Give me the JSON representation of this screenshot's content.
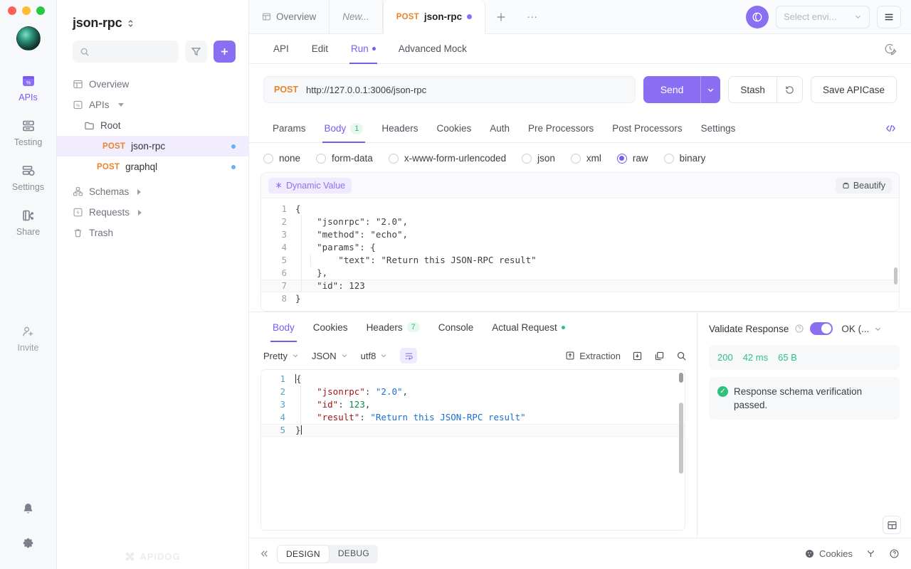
{
  "rail": {
    "items": [
      {
        "label": "APIs",
        "icon": "apis-icon",
        "active": true
      },
      {
        "label": "Testing",
        "icon": "testing-icon",
        "active": false
      },
      {
        "label": "Settings",
        "icon": "settings-icon",
        "active": false
      },
      {
        "label": "Share",
        "icon": "share-icon",
        "active": false
      }
    ],
    "invite_label": "Invite",
    "bell_icon": "bell-icon",
    "gear_icon": "gear-icon",
    "accent": "#7a5af5"
  },
  "sidebar": {
    "project_title": "json-rpc",
    "search_placeholder": "",
    "filter_icon": "filter-icon",
    "add_label": "+",
    "watermark": "APIDOG",
    "tree": [
      {
        "label": "Overview",
        "icon": "overview-icon",
        "level": 1,
        "selected": false
      },
      {
        "label": "APIs",
        "icon": "apis-small-icon",
        "level": 1,
        "selected": false,
        "caret": "down"
      },
      {
        "label": "Root",
        "icon": "folder-icon",
        "level": 2,
        "selected": false
      },
      {
        "label": "json-rpc",
        "verb": "POST",
        "level": 3,
        "selected": true,
        "dot": true
      },
      {
        "label": "graphql",
        "verb": "POST",
        "level": 3,
        "selected": false,
        "dot": true
      },
      {
        "label": "Schemas",
        "icon": "schemas-icon",
        "level": 1,
        "selected": false,
        "caret": "right"
      },
      {
        "label": "Requests",
        "icon": "requests-icon",
        "level": 1,
        "selected": false,
        "caret": "right"
      },
      {
        "label": "Trash",
        "icon": "trash-icon",
        "level": 1,
        "selected": false
      }
    ]
  },
  "tabbar": {
    "tabs": [
      {
        "label": "Overview",
        "icon": "overview-icon",
        "active": false,
        "italic": false,
        "dirty": false
      },
      {
        "label": "New...",
        "icon": "",
        "active": false,
        "italic": true,
        "dirty": false
      },
      {
        "label": "json-rpc",
        "verb": "POST",
        "active": true,
        "italic": false,
        "dirty": true
      }
    ],
    "add_tab": "+",
    "more_tabs": "···",
    "sync_icon": "sync-icon",
    "env_placeholder": "Select envi...",
    "menu_icon": "hamburger-icon"
  },
  "subtabs": {
    "items": [
      {
        "label": "API",
        "active": false,
        "dot": false
      },
      {
        "label": "Edit",
        "active": false,
        "dot": false
      },
      {
        "label": "Run",
        "active": true,
        "dot": true
      },
      {
        "label": "Advanced Mock",
        "active": false,
        "dot": false
      }
    ],
    "history_icon": "history-edit-icon"
  },
  "urlbar": {
    "method": "POST",
    "url": "http://127.0.0.1:3006/json-rpc",
    "send_label": "Send",
    "send_caret": "chevron-down-icon",
    "stash_label": "Stash",
    "reset_icon": "reset-icon",
    "save_label": "Save APICase"
  },
  "param_tabs": {
    "items": [
      {
        "label": "Params",
        "active": false,
        "badge": ""
      },
      {
        "label": "Body",
        "active": true,
        "badge": "1"
      },
      {
        "label": "Headers",
        "active": false,
        "badge": ""
      },
      {
        "label": "Cookies",
        "active": false,
        "badge": ""
      },
      {
        "label": "Auth",
        "active": false,
        "badge": ""
      },
      {
        "label": "Pre Processors",
        "active": false,
        "badge": ""
      },
      {
        "label": "Post Processors",
        "active": false,
        "badge": ""
      },
      {
        "label": "Settings",
        "active": false,
        "badge": ""
      }
    ],
    "code_icon": "code-brackets-icon"
  },
  "body_types": [
    {
      "label": "none",
      "selected": false
    },
    {
      "label": "form-data",
      "selected": false
    },
    {
      "label": "x-www-form-urlencoded",
      "selected": false
    },
    {
      "label": "json",
      "selected": false
    },
    {
      "label": "xml",
      "selected": false
    },
    {
      "label": "raw",
      "selected": true
    },
    {
      "label": "binary",
      "selected": false
    }
  ],
  "request_editor": {
    "dynamic_value_label": "Dynamic Value",
    "beautify_label": "Beautify",
    "lines": [
      {
        "n": "1",
        "text": "{",
        "highlight": false
      },
      {
        "n": "2",
        "text": "    \"jsonrpc\": \"2.0\",",
        "highlight": false
      },
      {
        "n": "3",
        "text": "    \"method\": \"echo\",",
        "highlight": false
      },
      {
        "n": "4",
        "text": "    \"params\": {",
        "highlight": false
      },
      {
        "n": "5",
        "text": "        \"text\": \"Return this JSON-RPC result\"",
        "highlight": false
      },
      {
        "n": "6",
        "text": "    },",
        "highlight": false
      },
      {
        "n": "7",
        "text": "    \"id\": 123",
        "highlight": true
      },
      {
        "n": "8",
        "text": "}",
        "highlight": false
      }
    ]
  },
  "response": {
    "tabs": [
      {
        "label": "Body",
        "active": true,
        "badge": "",
        "dot": false
      },
      {
        "label": "Cookies",
        "active": false,
        "badge": "",
        "dot": false
      },
      {
        "label": "Headers",
        "active": false,
        "badge": "7",
        "dot": false
      },
      {
        "label": "Console",
        "active": false,
        "badge": "",
        "dot": false
      },
      {
        "label": "Actual Request",
        "active": false,
        "badge": "",
        "dot": true
      }
    ],
    "toolbar": {
      "view_mode": "Pretty",
      "format": "JSON",
      "charset": "utf8",
      "wrap_icon": "word-wrap-icon",
      "extraction_label": "Extraction",
      "download_icon": "download-icon",
      "copy_icon": "copy-icon",
      "search_icon": "search-icon"
    },
    "lines": [
      {
        "n": "1",
        "segments": [
          {
            "t": "{",
            "c": "pun"
          }
        ],
        "highlight": false,
        "caret_start": true
      },
      {
        "n": "2",
        "segments": [
          {
            "t": "    ",
            "c": "pun"
          },
          {
            "t": "\"jsonrpc\"",
            "c": "key"
          },
          {
            "t": ": ",
            "c": "pun"
          },
          {
            "t": "\"2.0\"",
            "c": "str"
          },
          {
            "t": ",",
            "c": "pun"
          }
        ],
        "highlight": false
      },
      {
        "n": "3",
        "segments": [
          {
            "t": "    ",
            "c": "pun"
          },
          {
            "t": "\"id\"",
            "c": "key"
          },
          {
            "t": ": ",
            "c": "pun"
          },
          {
            "t": "123",
            "c": "num"
          },
          {
            "t": ",",
            "c": "pun"
          }
        ],
        "highlight": false
      },
      {
        "n": "4",
        "segments": [
          {
            "t": "    ",
            "c": "pun"
          },
          {
            "t": "\"result\"",
            "c": "key"
          },
          {
            "t": ": ",
            "c": "pun"
          },
          {
            "t": "\"Return this JSON-RPC result\"",
            "c": "str"
          }
        ],
        "highlight": false
      },
      {
        "n": "5",
        "segments": [
          {
            "t": "}",
            "c": "pun"
          }
        ],
        "highlight": true,
        "caret_end": true
      }
    ]
  },
  "validate": {
    "title": "Validate Response",
    "help_icon": "question-icon",
    "toggle_on": true,
    "selected_option": "OK (...",
    "status_code": "200",
    "time": "42 ms",
    "size": "65 B",
    "result_text": "Response schema verification passed.",
    "result_icon": "check-circle-icon",
    "success_color": "#2ec27e"
  },
  "bottombar": {
    "collapse_icon": "collapse-left-icon",
    "segments": [
      {
        "label": "DESIGN",
        "active": true
      },
      {
        "label": "DEBUG",
        "active": false
      }
    ],
    "cookies_label": "Cookies",
    "cookies_icon": "cookie-icon",
    "gift_icon": "gift-icon",
    "help_icon": "help-circle-icon",
    "layout_icon": "layout-panel-icon"
  }
}
